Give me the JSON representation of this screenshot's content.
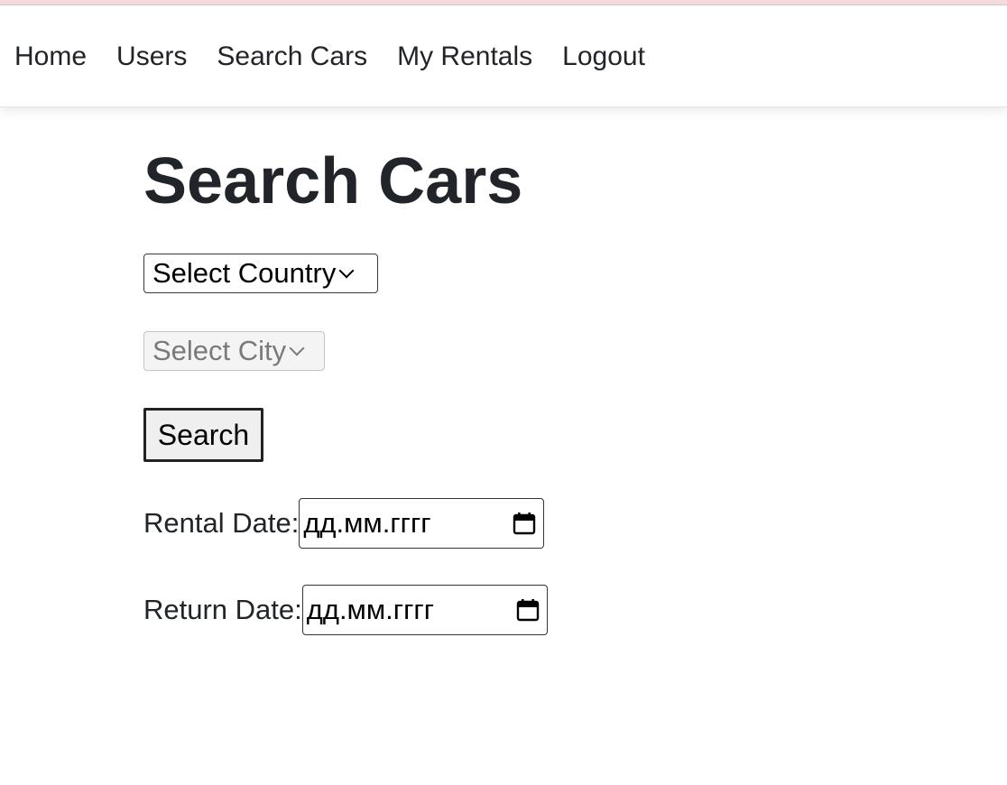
{
  "nav": {
    "items": [
      {
        "label": "Home"
      },
      {
        "label": "Users"
      },
      {
        "label": "Search Cars"
      },
      {
        "label": "My Rentals"
      },
      {
        "label": "Logout"
      }
    ]
  },
  "page": {
    "title": "Search Cars"
  },
  "form": {
    "country_select": {
      "selected": "Select Country",
      "disabled": false
    },
    "city_select": {
      "selected": "Select City",
      "disabled": true
    },
    "search_button_label": "Search",
    "rental_date": {
      "label": "Rental Date:",
      "placeholder": "дд.мм.гггг"
    },
    "return_date": {
      "label": "Return Date:",
      "placeholder": "дд.мм.гггг"
    }
  },
  "icons": {
    "calendar": "calendar-icon",
    "dropdown": "chevron-down-icon"
  },
  "colors": {
    "text": "#212529",
    "top_strip": "#f8dde0",
    "disabled_text": "#7a7a7a"
  }
}
